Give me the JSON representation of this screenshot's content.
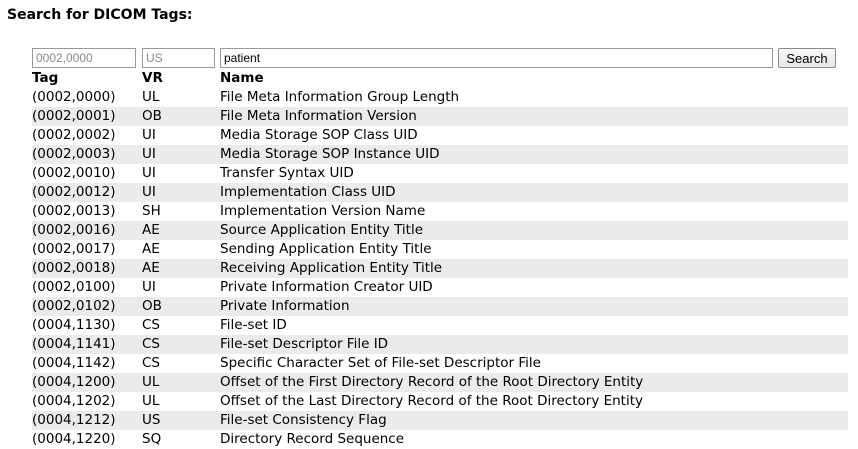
{
  "title": "Search for DICOM Tags:",
  "search": {
    "tag_placeholder": "0002,0000",
    "vr_placeholder": "US",
    "name_value": "patient",
    "button_label": "Search"
  },
  "table": {
    "headers": [
      "Tag",
      "VR",
      "Name"
    ],
    "rows": [
      {
        "tag": "(0002,0000)",
        "vr": "UL",
        "name": "File Meta Information Group Length"
      },
      {
        "tag": "(0002,0001)",
        "vr": "OB",
        "name": "File Meta Information Version"
      },
      {
        "tag": "(0002,0002)",
        "vr": "UI",
        "name": "Media Storage SOP Class UID"
      },
      {
        "tag": "(0002,0003)",
        "vr": "UI",
        "name": "Media Storage SOP Instance UID"
      },
      {
        "tag": "(0002,0010)",
        "vr": "UI",
        "name": "Transfer Syntax UID"
      },
      {
        "tag": "(0002,0012)",
        "vr": "UI",
        "name": "Implementation Class UID"
      },
      {
        "tag": "(0002,0013)",
        "vr": "SH",
        "name": "Implementation Version Name"
      },
      {
        "tag": "(0002,0016)",
        "vr": "AE",
        "name": "Source Application Entity Title"
      },
      {
        "tag": "(0002,0017)",
        "vr": "AE",
        "name": "Sending Application Entity Title"
      },
      {
        "tag": "(0002,0018)",
        "vr": "AE",
        "name": "Receiving Application Entity Title"
      },
      {
        "tag": "(0002,0100)",
        "vr": "UI",
        "name": "Private Information Creator UID"
      },
      {
        "tag": "(0002,0102)",
        "vr": "OB",
        "name": "Private Information"
      },
      {
        "tag": "(0004,1130)",
        "vr": "CS",
        "name": "File-set ID"
      },
      {
        "tag": "(0004,1141)",
        "vr": "CS",
        "name": "File-set Descriptor File ID"
      },
      {
        "tag": "(0004,1142)",
        "vr": "CS",
        "name": "Specific Character Set of File-set Descriptor File"
      },
      {
        "tag": "(0004,1200)",
        "vr": "UL",
        "name": "Offset of the First Directory Record of the Root Directory Entity"
      },
      {
        "tag": "(0004,1202)",
        "vr": "UL",
        "name": "Offset of the Last Directory Record of the Root Directory Entity"
      },
      {
        "tag": "(0004,1212)",
        "vr": "US",
        "name": "File-set Consistency Flag"
      },
      {
        "tag": "(0004,1220)",
        "vr": "SQ",
        "name": "Directory Record Sequence"
      }
    ]
  }
}
